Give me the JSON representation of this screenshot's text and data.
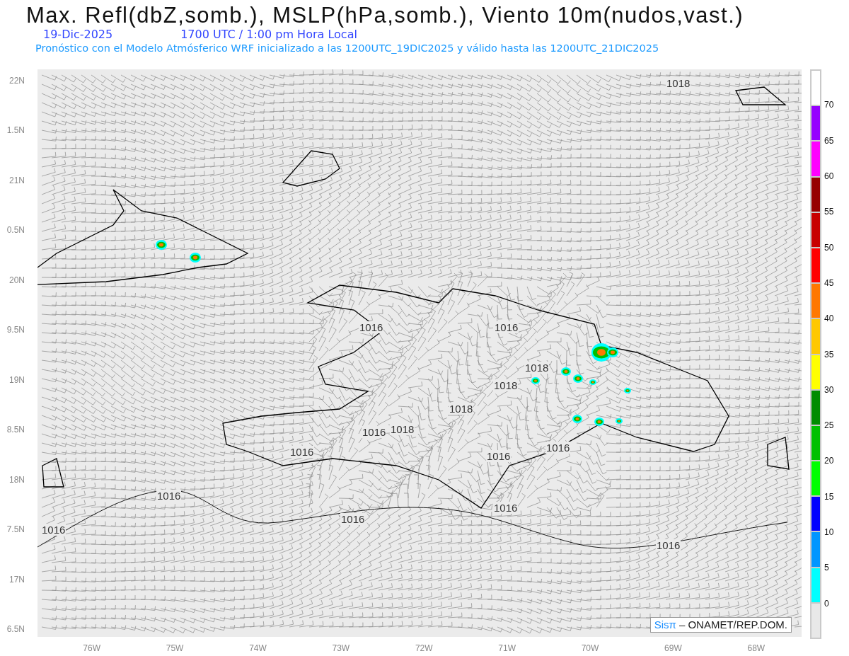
{
  "title": "Max. Refl(dbZ,somb.), MSLP(hPa,somb.), Viento 10m(nudos,vast.)",
  "date": "19-Dic-2025",
  "time": "1700 UTC / 1:00 pm Hora Local",
  "subtitle": "Pronóstico con el Modelo Atmósferico WRF inicializado a las 1200UTC_19DIC2025 y válido hasta las  1200UTC_21DIC2025",
  "y_labels": [
    "22N",
    "1.5N",
    "21N",
    "0.5N",
    "20N",
    "9.5N",
    "19N",
    "8.5N",
    "18N",
    "7.5N",
    "17N",
    "6.5N"
  ],
  "x_labels": [
    "76W",
    "75W",
    "74W",
    "73W",
    "72W",
    "71W",
    "70W",
    "69W",
    "68W"
  ],
  "isobar_labels": [
    "1018",
    "1016",
    "1016",
    "1018",
    "1018",
    "1018",
    "1016",
    "1018",
    "1016",
    "1016",
    "1016",
    "1016",
    "1016",
    "1016",
    "1016",
    "1016"
  ],
  "credit": {
    "brand": "Sisπ",
    "text": "– ONAMET/REP.DOM."
  },
  "colorbar": [
    {
      "color": "#ffffff",
      "label": "70"
    },
    {
      "color": "#9600ff",
      "label": "65"
    },
    {
      "color": "#ff00ff",
      "label": "60"
    },
    {
      "color": "#960000",
      "label": "55"
    },
    {
      "color": "#c80000",
      "label": "50"
    },
    {
      "color": "#ff0000",
      "label": "45"
    },
    {
      "color": "#ff7800",
      "label": "40"
    },
    {
      "color": "#ffc800",
      "label": "35"
    },
    {
      "color": "#ffff00",
      "label": "30"
    },
    {
      "color": "#008c00",
      "label": "25"
    },
    {
      "color": "#00c000",
      "label": "20"
    },
    {
      "color": "#00ff00",
      "label": "15"
    },
    {
      "color": "#0000ff",
      "label": "10"
    },
    {
      "color": "#0096ff",
      "label": "5"
    },
    {
      "color": "#00ffff",
      "label": "0"
    },
    {
      "color": "#e8e8e8"
    }
  ]
}
